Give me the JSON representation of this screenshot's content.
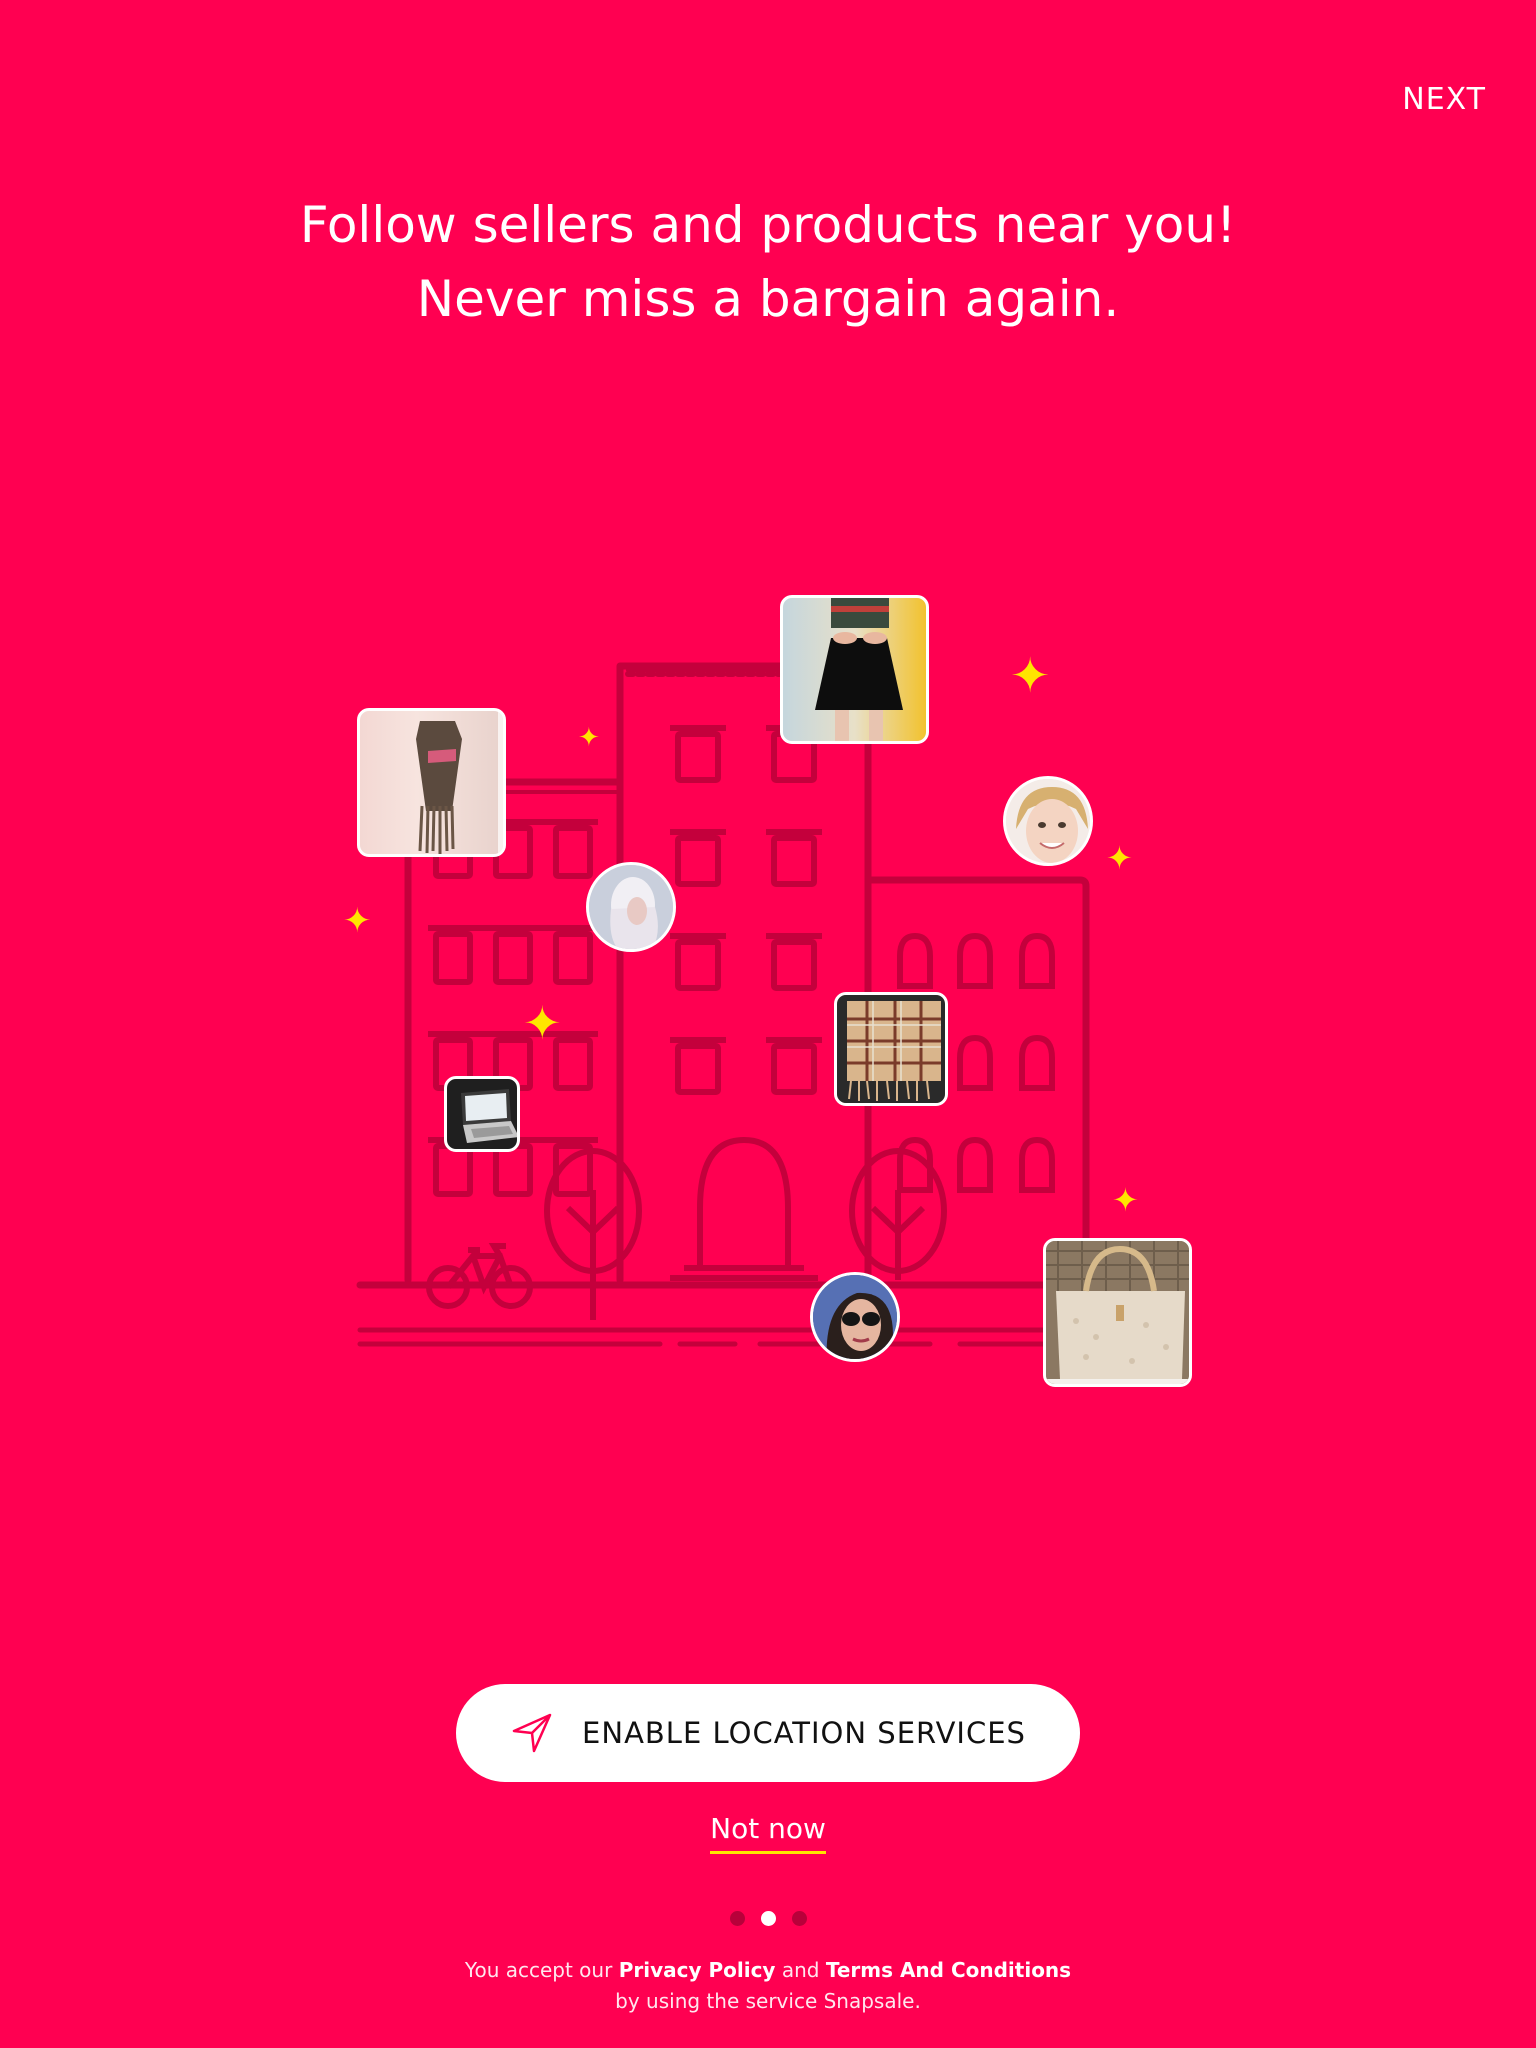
{
  "header": {
    "next_label": "NEXT"
  },
  "headline": {
    "line1": "Follow sellers and products near you!",
    "line2": "Never miss a bargain again."
  },
  "illustration": {
    "product_photos": [
      {
        "name": "fringe-backpack"
      },
      {
        "name": "black-skirt-outfit"
      },
      {
        "name": "plaid-scarf"
      },
      {
        "name": "laptop"
      },
      {
        "name": "tote-handbag"
      }
    ],
    "seller_avatars": [
      {
        "name": "seller-blonde"
      },
      {
        "name": "seller-smiling"
      },
      {
        "name": "seller-sunglasses"
      }
    ]
  },
  "cta": {
    "icon": "location-arrow-icon",
    "label": "ENABLE LOCATION SERVICES"
  },
  "secondary": {
    "not_now_label": "Not now"
  },
  "pager": {
    "pages": 3,
    "active_index": 1
  },
  "legal": {
    "prefix": "You accept our",
    "privacy_link": "Privacy Policy",
    "and": "and",
    "terms_link": "Terms And Conditions",
    "line2": "by using the service Snapsale."
  },
  "colors": {
    "background": "#FF0051",
    "accent_yellow": "#FFE500",
    "line_art": "#C4003C",
    "button_bg": "#FFFFFF"
  }
}
